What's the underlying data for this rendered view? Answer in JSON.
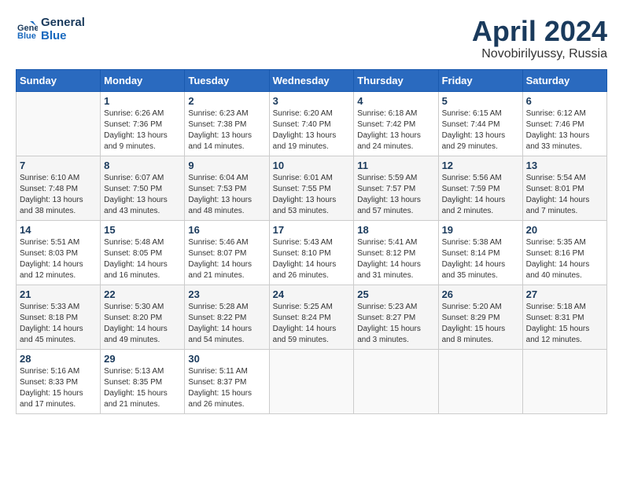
{
  "header": {
    "logo_line1": "General",
    "logo_line2": "Blue",
    "title": "April 2024",
    "subtitle": "Novobirilyussy, Russia"
  },
  "weekdays": [
    "Sunday",
    "Monday",
    "Tuesday",
    "Wednesday",
    "Thursday",
    "Friday",
    "Saturday"
  ],
  "weeks": [
    [
      {
        "day": "",
        "info": ""
      },
      {
        "day": "1",
        "info": "Sunrise: 6:26 AM\nSunset: 7:36 PM\nDaylight: 13 hours\nand 9 minutes."
      },
      {
        "day": "2",
        "info": "Sunrise: 6:23 AM\nSunset: 7:38 PM\nDaylight: 13 hours\nand 14 minutes."
      },
      {
        "day": "3",
        "info": "Sunrise: 6:20 AM\nSunset: 7:40 PM\nDaylight: 13 hours\nand 19 minutes."
      },
      {
        "day": "4",
        "info": "Sunrise: 6:18 AM\nSunset: 7:42 PM\nDaylight: 13 hours\nand 24 minutes."
      },
      {
        "day": "5",
        "info": "Sunrise: 6:15 AM\nSunset: 7:44 PM\nDaylight: 13 hours\nand 29 minutes."
      },
      {
        "day": "6",
        "info": "Sunrise: 6:12 AM\nSunset: 7:46 PM\nDaylight: 13 hours\nand 33 minutes."
      }
    ],
    [
      {
        "day": "7",
        "info": "Sunrise: 6:10 AM\nSunset: 7:48 PM\nDaylight: 13 hours\nand 38 minutes."
      },
      {
        "day": "8",
        "info": "Sunrise: 6:07 AM\nSunset: 7:50 PM\nDaylight: 13 hours\nand 43 minutes."
      },
      {
        "day": "9",
        "info": "Sunrise: 6:04 AM\nSunset: 7:53 PM\nDaylight: 13 hours\nand 48 minutes."
      },
      {
        "day": "10",
        "info": "Sunrise: 6:01 AM\nSunset: 7:55 PM\nDaylight: 13 hours\nand 53 minutes."
      },
      {
        "day": "11",
        "info": "Sunrise: 5:59 AM\nSunset: 7:57 PM\nDaylight: 13 hours\nand 57 minutes."
      },
      {
        "day": "12",
        "info": "Sunrise: 5:56 AM\nSunset: 7:59 PM\nDaylight: 14 hours\nand 2 minutes."
      },
      {
        "day": "13",
        "info": "Sunrise: 5:54 AM\nSunset: 8:01 PM\nDaylight: 14 hours\nand 7 minutes."
      }
    ],
    [
      {
        "day": "14",
        "info": "Sunrise: 5:51 AM\nSunset: 8:03 PM\nDaylight: 14 hours\nand 12 minutes."
      },
      {
        "day": "15",
        "info": "Sunrise: 5:48 AM\nSunset: 8:05 PM\nDaylight: 14 hours\nand 16 minutes."
      },
      {
        "day": "16",
        "info": "Sunrise: 5:46 AM\nSunset: 8:07 PM\nDaylight: 14 hours\nand 21 minutes."
      },
      {
        "day": "17",
        "info": "Sunrise: 5:43 AM\nSunset: 8:10 PM\nDaylight: 14 hours\nand 26 minutes."
      },
      {
        "day": "18",
        "info": "Sunrise: 5:41 AM\nSunset: 8:12 PM\nDaylight: 14 hours\nand 31 minutes."
      },
      {
        "day": "19",
        "info": "Sunrise: 5:38 AM\nSunset: 8:14 PM\nDaylight: 14 hours\nand 35 minutes."
      },
      {
        "day": "20",
        "info": "Sunrise: 5:35 AM\nSunset: 8:16 PM\nDaylight: 14 hours\nand 40 minutes."
      }
    ],
    [
      {
        "day": "21",
        "info": "Sunrise: 5:33 AM\nSunset: 8:18 PM\nDaylight: 14 hours\nand 45 minutes."
      },
      {
        "day": "22",
        "info": "Sunrise: 5:30 AM\nSunset: 8:20 PM\nDaylight: 14 hours\nand 49 minutes."
      },
      {
        "day": "23",
        "info": "Sunrise: 5:28 AM\nSunset: 8:22 PM\nDaylight: 14 hours\nand 54 minutes."
      },
      {
        "day": "24",
        "info": "Sunrise: 5:25 AM\nSunset: 8:24 PM\nDaylight: 14 hours\nand 59 minutes."
      },
      {
        "day": "25",
        "info": "Sunrise: 5:23 AM\nSunset: 8:27 PM\nDaylight: 15 hours\nand 3 minutes."
      },
      {
        "day": "26",
        "info": "Sunrise: 5:20 AM\nSunset: 8:29 PM\nDaylight: 15 hours\nand 8 minutes."
      },
      {
        "day": "27",
        "info": "Sunrise: 5:18 AM\nSunset: 8:31 PM\nDaylight: 15 hours\nand 12 minutes."
      }
    ],
    [
      {
        "day": "28",
        "info": "Sunrise: 5:16 AM\nSunset: 8:33 PM\nDaylight: 15 hours\nand 17 minutes."
      },
      {
        "day": "29",
        "info": "Sunrise: 5:13 AM\nSunset: 8:35 PM\nDaylight: 15 hours\nand 21 minutes."
      },
      {
        "day": "30",
        "info": "Sunrise: 5:11 AM\nSunset: 8:37 PM\nDaylight: 15 hours\nand 26 minutes."
      },
      {
        "day": "",
        "info": ""
      },
      {
        "day": "",
        "info": ""
      },
      {
        "day": "",
        "info": ""
      },
      {
        "day": "",
        "info": ""
      }
    ]
  ]
}
